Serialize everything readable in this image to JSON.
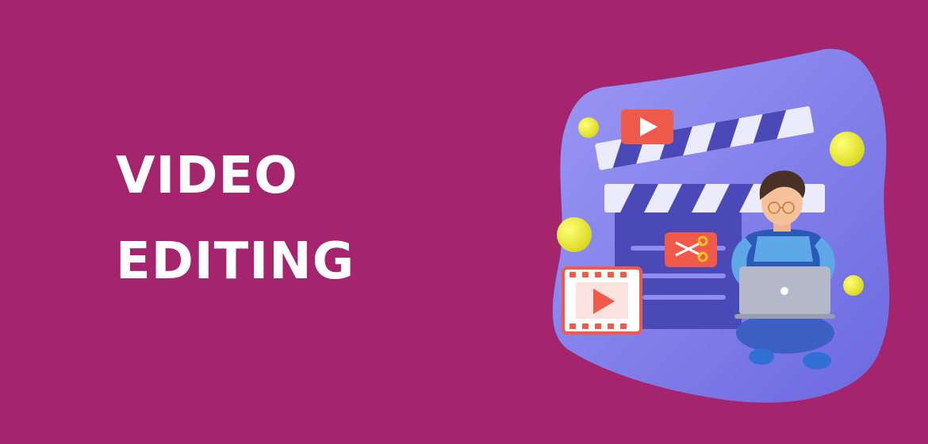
{
  "banner": {
    "background_color": "#a4256e",
    "headline": {
      "line1": "VIDEO",
      "line2": "EDITING"
    }
  },
  "illustration": {
    "blob_color": "#7f7de8",
    "ball_color": "#f3f22c",
    "accent_color": "#ef5a4a",
    "icons": [
      "play-icon",
      "scissors-icon",
      "film-strip-icon",
      "clapperboard-icon",
      "laptop-icon",
      "person-icon"
    ]
  }
}
